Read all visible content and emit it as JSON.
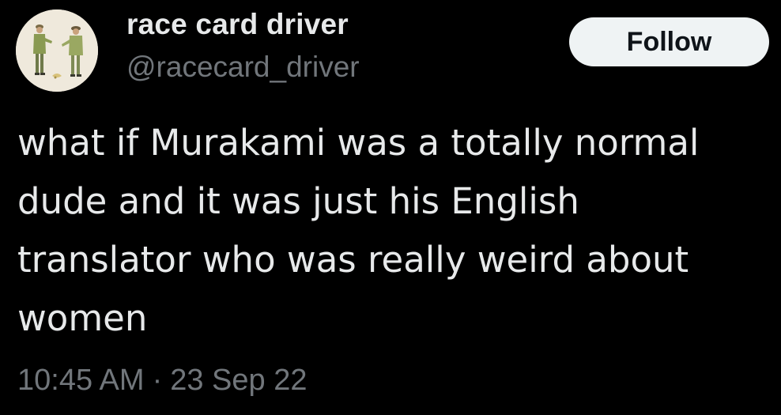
{
  "author": {
    "display_name": "race card driver",
    "handle": "@racecard_driver",
    "avatar_icon": "two-figures-illustration-avatar"
  },
  "follow_button": {
    "label": "Follow"
  },
  "tweet": {
    "lines": [
      "what if Murakami was a totally normal",
      "dude and it was just his English",
      "translator who was really weird about",
      "women"
    ]
  },
  "meta": {
    "time": "10:45 AM",
    "separator": "·",
    "date": "23 Sep 22"
  },
  "colors": {
    "background": "#000000",
    "text_primary": "#e7e9ea",
    "text_secondary": "#71767b",
    "button_bg": "#eff3f4",
    "button_text": "#0f1419"
  }
}
